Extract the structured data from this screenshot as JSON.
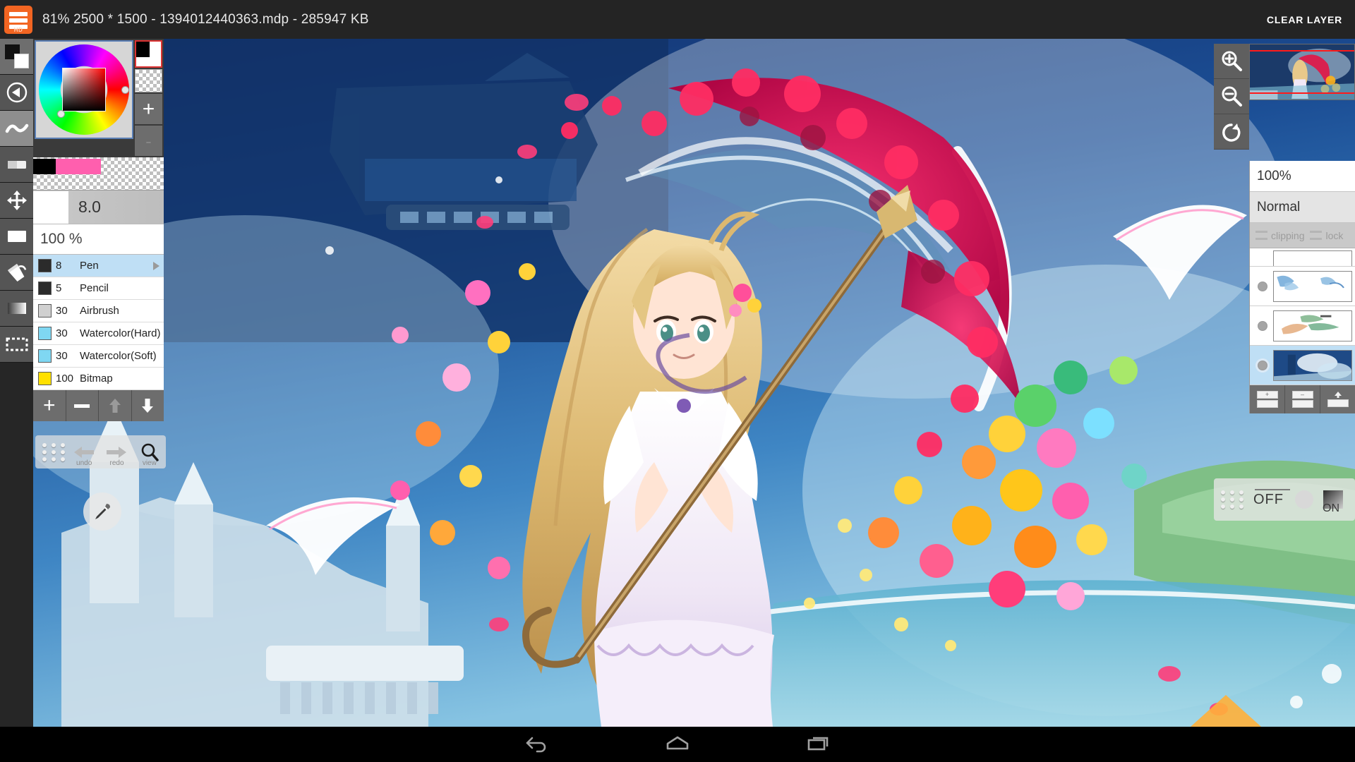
{
  "titlebar": {
    "app_icon": "hamburger-hd-icon",
    "app_icon_label": "HD",
    "title": "81% 2500 * 1500 - 1394012440363.mdp - 285947 KB",
    "clear_layer_label": "CLEAR LAYER"
  },
  "tool_rail": {
    "items": [
      {
        "name": "foreground-background-swatch",
        "icon": "color-swatch-icon",
        "active": false
      },
      {
        "name": "back-navigate-tool",
        "icon": "play-back-circle-icon",
        "active": false
      },
      {
        "name": "freehand-brush-tool",
        "icon": "wavy-line-icon",
        "active": true
      },
      {
        "name": "eraser-tool",
        "icon": "eraser-icon",
        "active": false
      },
      {
        "name": "move-tool",
        "icon": "move-arrows-icon",
        "active": false
      },
      {
        "name": "fill-rect-tool",
        "icon": "filled-rectangle-icon",
        "active": false
      },
      {
        "name": "bucket-fill-tool",
        "icon": "paint-bucket-icon",
        "active": false
      },
      {
        "name": "gradient-tool",
        "icon": "gradient-icon",
        "active": false
      },
      {
        "name": "select-tool",
        "icon": "marquee-select-icon",
        "active": false
      }
    ]
  },
  "color_panel": {
    "wheel_name": "hsv-color-wheel",
    "fg_color": "#000000",
    "bg_color": "#ffffff",
    "transparent_label": "transparent",
    "add_color_label": "+",
    "remove_color_label": "-",
    "swatches": [
      "#000000",
      "#ff5fae",
      "#ff5fae"
    ]
  },
  "brush_panel": {
    "size_value": "8.0",
    "opacity_value": "100 %",
    "brushes": [
      {
        "num": "8",
        "name": "Pen",
        "chip": "#2b2b2b",
        "selected": true
      },
      {
        "num": "5",
        "name": "Pencil",
        "chip": "#2b2b2b",
        "selected": false
      },
      {
        "num": "30",
        "name": "Airbrush",
        "chip": "#d0d0d0",
        "selected": false
      },
      {
        "num": "30",
        "name": "Watercolor(Hard)",
        "chip": "#7fd7f2",
        "selected": false
      },
      {
        "num": "30",
        "name": "Watercolor(Soft)",
        "chip": "#7fd7f2",
        "selected": false
      },
      {
        "num": "100",
        "name": "Bitmap",
        "chip": "#ffe000",
        "selected": false
      }
    ],
    "actions": [
      {
        "name": "add-brush-button",
        "icon": "plus-icon",
        "enabled": true
      },
      {
        "name": "remove-brush-button",
        "icon": "minus-icon",
        "enabled": true
      },
      {
        "name": "move-brush-up-button",
        "icon": "arrow-up-icon",
        "enabled": false
      },
      {
        "name": "move-brush-down-button",
        "icon": "arrow-down-icon",
        "enabled": true
      }
    ]
  },
  "undo_bar": {
    "undo_label": "undo",
    "redo_label": "redo",
    "view_label": "view"
  },
  "eyedropper": {
    "name": "eyedropper-tool",
    "icon": "eyedropper-icon"
  },
  "zoom_controls": [
    {
      "name": "zoom-in-button",
      "icon": "magnifier-plus-icon"
    },
    {
      "name": "zoom-out-button",
      "icon": "magnifier-minus-icon"
    },
    {
      "name": "rotate-reset-button",
      "icon": "rotate-icon"
    }
  ],
  "navigator": {
    "name": "canvas-navigator",
    "viewport_color": "#ff1a1a"
  },
  "layer_panel": {
    "opacity_value": "100%",
    "blend_mode": "Normal",
    "clipping_label": "clipping",
    "lock_label": "lock",
    "layers": [
      {
        "name": "layer-row-partial",
        "visible": true,
        "selected": false,
        "partial": true
      },
      {
        "name": "layer-row-3",
        "visible": true,
        "selected": false,
        "partial": false
      },
      {
        "name": "layer-row-2",
        "visible": true,
        "selected": false,
        "partial": false
      },
      {
        "name": "layer-row-1",
        "visible": true,
        "selected": true,
        "partial": false
      }
    ],
    "actions": [
      {
        "name": "add-layer-button",
        "icon": "layer-plus-icon"
      },
      {
        "name": "delete-layer-button",
        "icon": "layer-minus-icon"
      },
      {
        "name": "merge-layer-button",
        "icon": "layer-merge-icon"
      }
    ]
  },
  "stabilizer_bar": {
    "off_label": "OFF",
    "on_label": "ON"
  },
  "android_nav": [
    {
      "name": "android-back-button",
      "icon": "back-arrow-icon"
    },
    {
      "name": "android-home-button",
      "icon": "home-icon"
    },
    {
      "name": "android-recents-button",
      "icon": "recents-icon"
    }
  ]
}
